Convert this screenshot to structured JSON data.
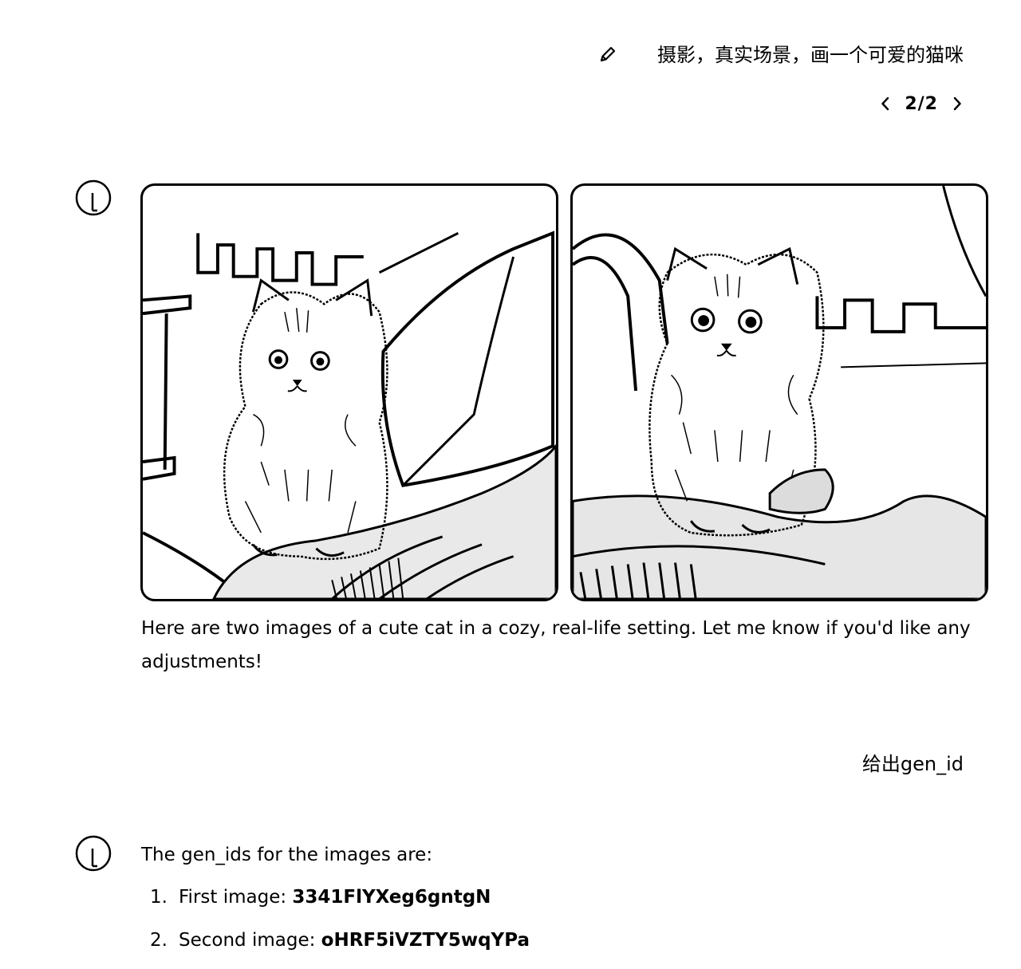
{
  "user_message_1": {
    "text": "摄影，真实场景，画一个可爱的猫咪",
    "edit_icon": "pencil-icon"
  },
  "pagination": {
    "label": "2/2",
    "prev_icon": "chevron-left-icon",
    "next_icon": "chevron-right-icon"
  },
  "assistant_avatar_icon": "assistant-logo-icon",
  "assistant_reply_1": {
    "images": [
      "cat-photo-1",
      "cat-photo-2"
    ],
    "text": "Here are two images of a cute cat in a cozy, real-life setting. Let me know if you'd like any adjustments!"
  },
  "user_message_2": {
    "text": "给出gen_id"
  },
  "assistant_reply_2": {
    "intro": "The gen_ids for the images are:",
    "items": [
      {
        "number": "1.",
        "label": "First image: ",
        "gen_id": "3341FlYXeg6gntgN"
      },
      {
        "number": "2.",
        "label": "Second image: ",
        "gen_id": "oHRF5iVZTY5wqYPa"
      }
    ]
  }
}
